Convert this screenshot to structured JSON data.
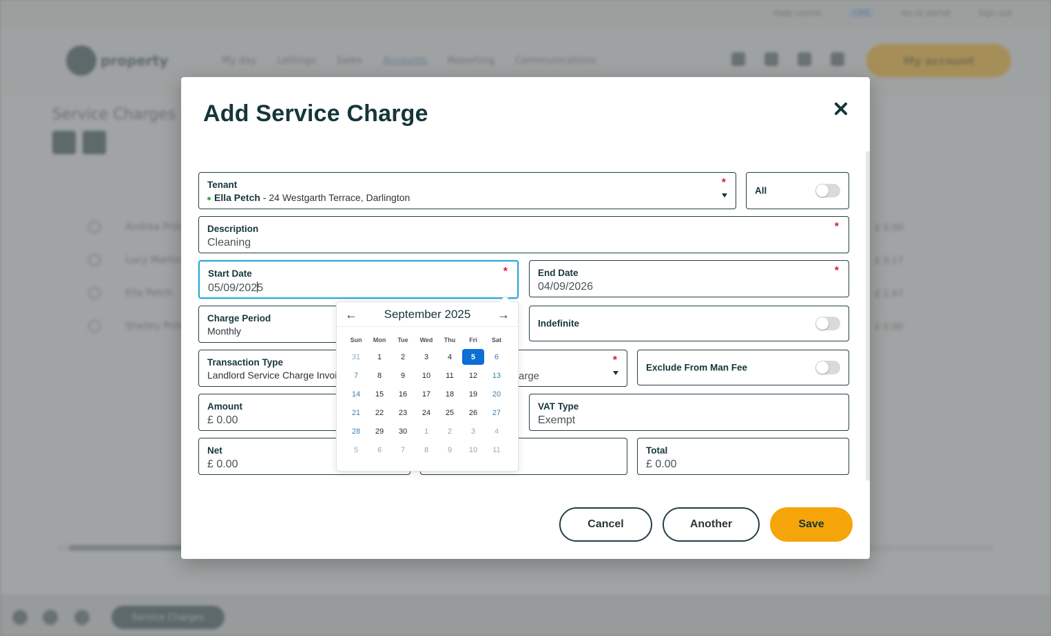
{
  "background": {
    "top_links": [
      "Help centre",
      "CRS",
      "Go to portal",
      "Sign out"
    ],
    "logo_text": "property",
    "menu": [
      "My day",
      "Lettings",
      "Sales",
      "Accounts",
      "Reporting",
      "Communications"
    ],
    "account_button": "My account",
    "page_title": "Service Charges",
    "rows": [
      {
        "name": "Andrea Pringle",
        "amount": "£ 0.00"
      },
      {
        "name": "Lucy Martin",
        "amount": "£ 0.17"
      },
      {
        "name": "Ella Petch",
        "amount": "£ 1.47"
      },
      {
        "name": "Shelley Pringle",
        "amount": "£ 0.00"
      }
    ],
    "footer_pill": "Service Charges"
  },
  "modal": {
    "title": "Add Service Charge",
    "tenant": {
      "label": "Tenant",
      "name": "Ella Petch",
      "address": " - 24 Westgarth Terrace, Darlington"
    },
    "all": {
      "label": "All",
      "on": false
    },
    "description": {
      "label": "Description",
      "value": "Cleaning"
    },
    "start_date": {
      "label": "Start Date",
      "value_before_cursor": "05/09/202",
      "value_after_cursor": "5"
    },
    "end_date": {
      "label": "End Date",
      "value": "04/09/2026"
    },
    "charge_period": {
      "label": "Charge Period",
      "value": "Monthly"
    },
    "indefinite": {
      "label": "Indefinite",
      "on": false
    },
    "transaction_type": {
      "label": "Transaction Type",
      "value": "Landlord Service Charge Invoice"
    },
    "charge_field": {
      "value": "arge"
    },
    "exclude_man_fee": {
      "label": "Exclude From Man Fee",
      "on": false
    },
    "amount": {
      "label": "Amount",
      "value": "£ 0.00"
    },
    "vat_type": {
      "label": "VAT Type",
      "value": "Exempt"
    },
    "net": {
      "label": "Net",
      "value": "£ 0.00"
    },
    "total": {
      "label": "Total",
      "value": "£ 0.00"
    },
    "required_mark": "*",
    "buttons": {
      "cancel": "Cancel",
      "another": "Another",
      "save": "Save"
    }
  },
  "calendar": {
    "month_label": "September 2025",
    "prev_icon": "arrow-left-icon",
    "next_icon": "arrow-right-icon",
    "weekdays": [
      "Sun",
      "Mon",
      "Tue",
      "Wed",
      "Thu",
      "Fri",
      "Sat"
    ],
    "days": [
      "31",
      "1",
      "2",
      "3",
      "4",
      "5",
      "6",
      "7",
      "8",
      "9",
      "10",
      "11",
      "12",
      "13",
      "14",
      "15",
      "16",
      "17",
      "18",
      "19",
      "20",
      "21",
      "22",
      "23",
      "24",
      "25",
      "26",
      "27",
      "28",
      "29",
      "30",
      "1",
      "2",
      "3",
      "4",
      "5",
      "6",
      "7",
      "8",
      "9",
      "10",
      "11"
    ],
    "selected": "5",
    "accent_color": "#0d6ed6"
  },
  "colors": {
    "primary_button": "#f5a50a",
    "focus_border": "#2aa8d8",
    "dark_text": "#15363a",
    "required": "#d21f2f"
  }
}
